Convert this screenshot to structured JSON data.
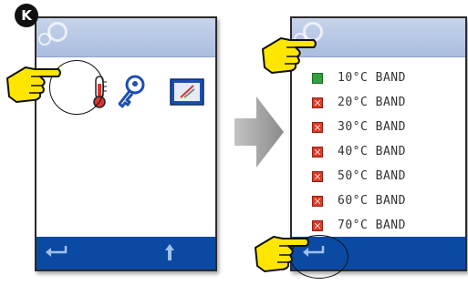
{
  "step_badge": "K",
  "left_screen": {
    "icons": [
      "thermometer-icon",
      "key-icon",
      "monitor-icon"
    ],
    "bottom": [
      "back-arrow-icon",
      "up-arrow-icon"
    ]
  },
  "right_screen": {
    "bands": [
      {
        "label": "10°C BAND",
        "state": "on"
      },
      {
        "label": "20°C BAND",
        "state": "off"
      },
      {
        "label": "30°C BAND",
        "state": "off"
      },
      {
        "label": "40°C BAND",
        "state": "off"
      },
      {
        "label": "50°C BAND",
        "state": "off"
      },
      {
        "label": "60°C BAND",
        "state": "off"
      },
      {
        "label": "70°C BAND",
        "state": "off"
      }
    ],
    "bottom": [
      "back-arrow-icon"
    ]
  },
  "colors": {
    "topbar": "#b7c7e4",
    "bottombar": "#0b4aa3",
    "on": "#31a140",
    "off": "#dd3b26",
    "hand": "#ffe600",
    "arrow": "#9a9a9a"
  }
}
